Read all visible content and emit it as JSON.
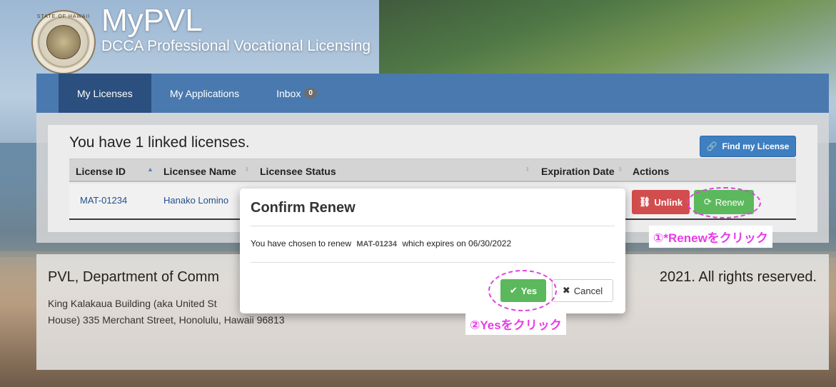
{
  "header": {
    "seal_text": "STATE OF HAWAII",
    "title": "MyPVL",
    "subtitle": "DCCA Professional Vocational Licensing"
  },
  "nav": {
    "tabs": [
      {
        "label": "My Licenses",
        "active": true
      },
      {
        "label": "My Applications",
        "active": false
      },
      {
        "label": "Inbox",
        "active": false,
        "badge": "0"
      }
    ]
  },
  "licenses": {
    "heading": "You have 1 linked licenses.",
    "find_button": "Find my License",
    "columns": [
      "License ID",
      "Licensee Name",
      "Licensee Status",
      "Expiration Date",
      "Actions"
    ],
    "rows": [
      {
        "license_id": "MAT-01234",
        "licensee_name": "Hanako Lomino",
        "status": "",
        "expiration": ""
      }
    ],
    "unlink_label": "Unlink",
    "renew_label": "Renew"
  },
  "footer": {
    "title": "PVL, Department of Comm",
    "rights": "2021. All rights reserved.",
    "address_line1": "King Kalakaua Building (aka United St",
    "address_line2": "House) 335 Merchant Street, Honolulu, Hawaii 96813"
  },
  "modal": {
    "title": "Confirm Renew",
    "body_prefix": "You have chosen to renew",
    "license_id": "MAT-01234",
    "body_suffix": "which expires on 06/30/2022",
    "yes_label": "Yes",
    "cancel_label": "Cancel"
  },
  "annotations": {
    "step1": "①*Renewをクリック",
    "step2": "②Yesをクリック"
  },
  "colors": {
    "nav": "#4a79b0",
    "nav_active": "#2b4f7e",
    "primary": "#3d7fc1",
    "danger": "#d24d4d",
    "success": "#5cb85c",
    "annotation": "#e83ae8"
  }
}
